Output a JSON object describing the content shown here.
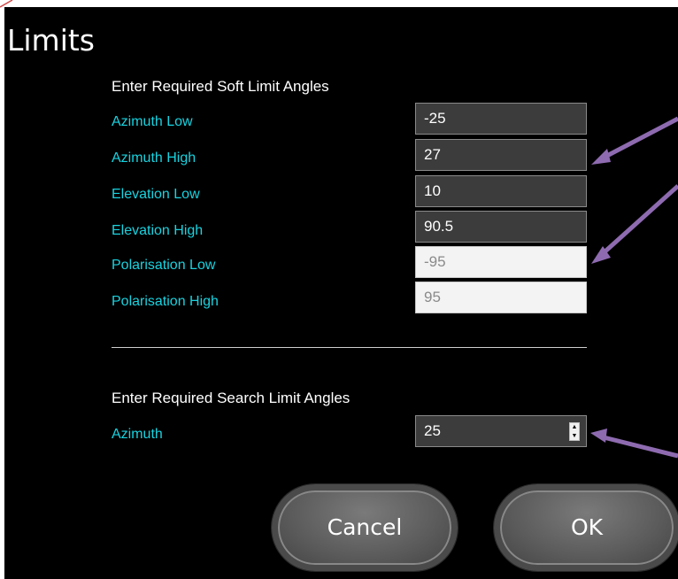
{
  "window": {
    "title": "Limits"
  },
  "soft_limits": {
    "heading": "Enter Required Soft Limit Angles",
    "fields": [
      {
        "label": "Azimuth Low",
        "value": "-25",
        "enabled": true
      },
      {
        "label": "Azimuth High",
        "value": "27",
        "enabled": true
      },
      {
        "label": "Elevation Low",
        "value": "10",
        "enabled": true
      },
      {
        "label": "Elevation High",
        "value": "90.5",
        "enabled": true
      },
      {
        "label": "Polarisation Low",
        "value": "-95",
        "enabled": false
      },
      {
        "label": "Polarisation High",
        "value": "95",
        "enabled": false
      }
    ]
  },
  "search_limits": {
    "heading": "Enter Required Search Limit Angles",
    "azimuth": {
      "label": "Azimuth",
      "value": "25"
    }
  },
  "buttons": {
    "cancel": "Cancel",
    "ok": "OK"
  },
  "colors": {
    "background": "#000000",
    "label": "#18d3e0",
    "annotation_arrow": "#8e6bb0"
  },
  "icons": {
    "spinner": "up-down-spinner-icon",
    "annotations": "arrow-icon"
  }
}
